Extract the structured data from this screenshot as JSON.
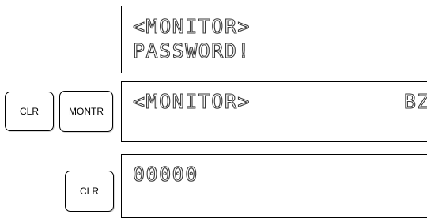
{
  "display1": {
    "line1": "<MONITOR>",
    "line2": "PASSWORD!"
  },
  "display2": {
    "line1": "<MONITOR>",
    "line1_right": "BZ"
  },
  "display3": {
    "line1": "00000"
  },
  "keys": {
    "clr_1": "CLR",
    "montr": "MONTR",
    "clr_2": "CLR"
  }
}
